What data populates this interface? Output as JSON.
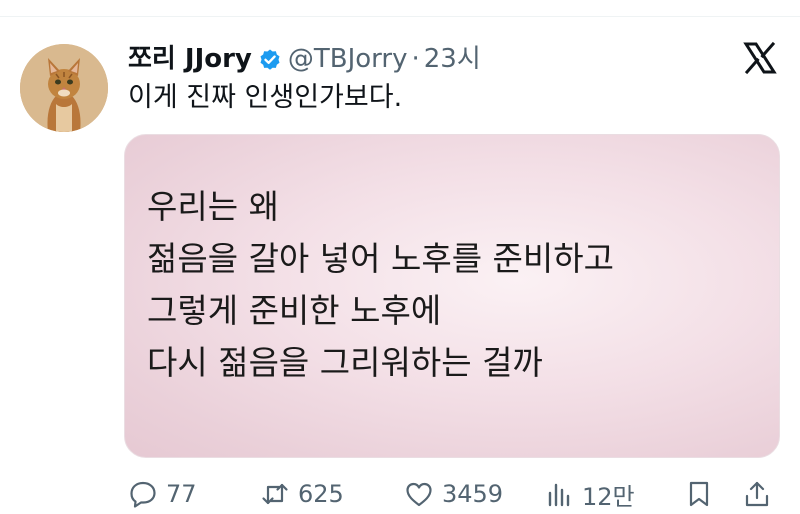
{
  "tweet": {
    "display_name": "쪼리 JJory",
    "handle": "@TBJorry",
    "separator": "·",
    "time": "23시",
    "text": "이게 진짜 인생인가보다.",
    "verified": true
  },
  "media": {
    "lines": [
      "우리는 왜",
      "젊음을 갈아 넣어 노후를 준비하고",
      "그렇게 준비한 노후에",
      "다시 젊음을 그리워하는 걸까"
    ]
  },
  "actions": {
    "replies": "77",
    "reposts": "625",
    "likes": "3459",
    "views": "12만"
  },
  "icons": {
    "verified": "verified-badge-icon",
    "brand": "x-logo-icon",
    "reply": "reply-icon",
    "repost": "repost-icon",
    "like": "heart-icon",
    "views": "views-icon",
    "bookmark": "bookmark-icon",
    "share": "share-icon"
  },
  "colors": {
    "verified": "#1d9bf0",
    "secondary_text": "#536471",
    "primary_text": "#0f1419",
    "media_bg": "#f3dfe6"
  }
}
